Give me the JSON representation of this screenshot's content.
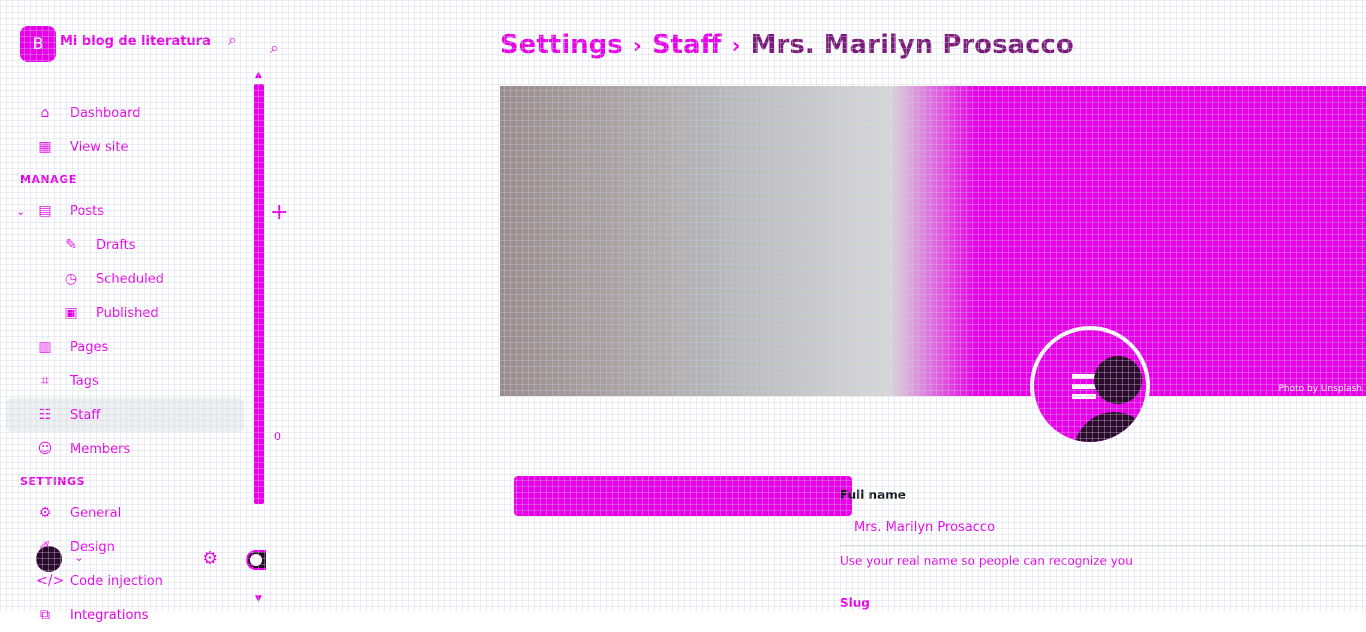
{
  "brand": {
    "name": "Mi blog de literatura",
    "logo_text": "B"
  },
  "sidebar": {
    "items": [
      {
        "label": "Dashboard",
        "icon": "home-icon",
        "glyph": "⌂"
      },
      {
        "label": "View site",
        "icon": "layout-icon",
        "glyph": "▦"
      }
    ],
    "manage_heading": "MANAGE",
    "manage_items": [
      {
        "label": "Posts",
        "icon": "posts-icon",
        "glyph": "▤"
      },
      {
        "label": "Drafts",
        "icon": "pencil-icon",
        "glyph": "✎"
      },
      {
        "label": "Scheduled",
        "icon": "clock-icon",
        "glyph": "◷"
      },
      {
        "label": "Published",
        "icon": "published-icon",
        "glyph": "▣"
      },
      {
        "label": "Pages",
        "icon": "pages-icon",
        "glyph": "▥"
      },
      {
        "label": "Tags",
        "icon": "tag-icon",
        "glyph": "⌗"
      },
      {
        "label": "Staff",
        "icon": "staff-icon",
        "glyph": "☷"
      },
      {
        "label": "Members",
        "icon": "members-icon",
        "glyph": "☺"
      }
    ],
    "settings_heading": "SETTINGS",
    "settings_items": [
      {
        "label": "General",
        "icon": "gear-icon",
        "glyph": "⚙"
      },
      {
        "label": "Design",
        "icon": "design-icon",
        "glyph": "✐"
      },
      {
        "label": "Code injection",
        "icon": "code-icon",
        "glyph": "</>"
      },
      {
        "label": "Integrations",
        "icon": "integrations-icon",
        "glyph": "⧉"
      }
    ]
  },
  "middle": {
    "count": "0"
  },
  "header": {
    "breadcrumb_root": "Settings",
    "breadcrumb_sep": "›",
    "breadcrumb_current": "Staff",
    "title": "Mrs. Marilyn Prosacco"
  },
  "profile": {
    "cover_caption": "Photo by Unsplash",
    "full_name_label": "Full name",
    "full_name_value": "Mrs. Marilyn Prosacco",
    "full_name_hint": "Use your real name so people can recognize you",
    "slug_label": "Slug"
  },
  "colors": {
    "accent": "#e800e8",
    "dark": "#2b0a2b"
  }
}
